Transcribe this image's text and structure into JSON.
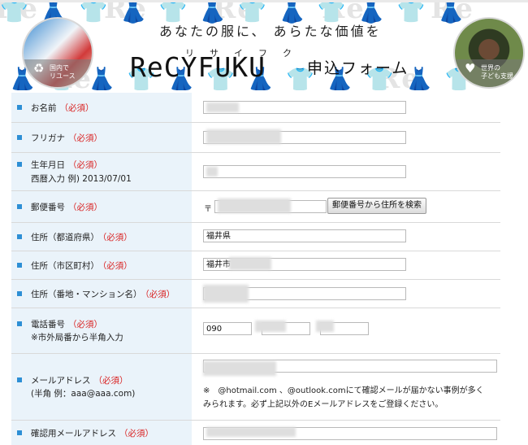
{
  "header": {
    "watermark": "Re",
    "catchphrase": "あなたの服に、 あらたな価値を",
    "brand_ruby": "リサイフク",
    "brand_name": "ReCYFUKU",
    "form_title": "申込フォーム",
    "badge_left": {
      "caption_line1": "国内で",
      "caption_line2": "リユース",
      "icon": "recycle-icon"
    },
    "badge_right": {
      "caption_line1": "世界の",
      "caption_line2": "子ども支援",
      "icon": "heart-icon"
    }
  },
  "form": {
    "required_text": "（必須）",
    "fields": {
      "name": {
        "label": "お名前",
        "value": ""
      },
      "furigana": {
        "label": "フリガナ",
        "value": ""
      },
      "birthday": {
        "label": "生年月日",
        "sub": "西暦入力 例) 2013/07/01",
        "value": ""
      },
      "postal": {
        "label": "郵便番号",
        "prefix": "〒",
        "value": "",
        "search_button": "郵便番号から住所を検索"
      },
      "prefecture": {
        "label": "住所（都道府県）",
        "value": "福井県"
      },
      "city": {
        "label": "住所（市区町村）",
        "value": "福井市"
      },
      "address": {
        "label": "住所（番地・マンション名）",
        "value": ""
      },
      "phone": {
        "label": "電話番号",
        "sub": "※市外局番から半角入力",
        "part1": "090",
        "part2": "",
        "part3": ""
      },
      "email": {
        "label": "メールアドレス",
        "sub": "(半角 例：aaa@aaa.com)",
        "value": "",
        "note_line1": "※　@hotmail.com 、@outlook.comにて確認メールが届かない事例が多く",
        "note_line2": "みられます。必ず上記以外のEメールアドレスをご登録ください。"
      },
      "email_confirm": {
        "label": "確認用メールアドレス",
        "value": ""
      }
    }
  },
  "colors": {
    "accent": "#2d8fd5",
    "required": "#d92020",
    "label_bg": "#eaf3fa"
  }
}
